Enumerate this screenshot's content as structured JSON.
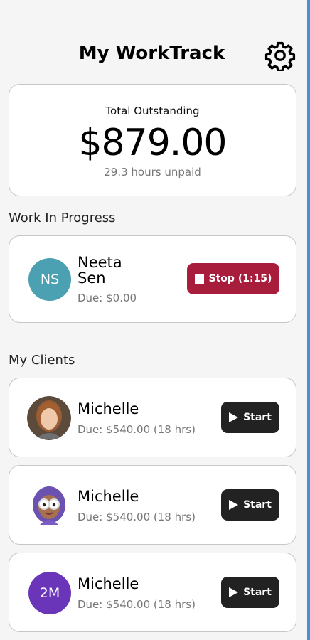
{
  "app": {
    "title": "My WorkTrack"
  },
  "summary": {
    "label": "Total Outstanding",
    "amount": "$879.00",
    "hours_text": "29.3 hours unpaid"
  },
  "in_progress": {
    "section_label": "Work In Progress",
    "client": {
      "initials": "NS",
      "name_line1": "Neeta",
      "name_line2": "Sen",
      "due": "Due: $0.00",
      "avatar_color": "#4ba0b2",
      "button_label": "Stop (1:15)",
      "button_color": "#a81c3c"
    }
  },
  "clients": {
    "section_label": "My Clients",
    "items": [
      {
        "name": "Michelle",
        "due": "Due: $540.00 (18 hrs)",
        "avatar": "photo",
        "button_label": "Start"
      },
      {
        "name": "Michelle",
        "due": "Due: $540.00 (18 hrs)",
        "avatar": "memoji",
        "button_label": "Start"
      },
      {
        "name": "Michelle",
        "due": "Due: $540.00 (18 hrs)",
        "avatar": "initials",
        "initials": "2M",
        "avatar_color": "#6a35b8",
        "button_label": "Start"
      }
    ]
  },
  "colors": {
    "background": "#f5f5f5",
    "start_button": "#222222",
    "accent_edge": "#4a90d9"
  }
}
